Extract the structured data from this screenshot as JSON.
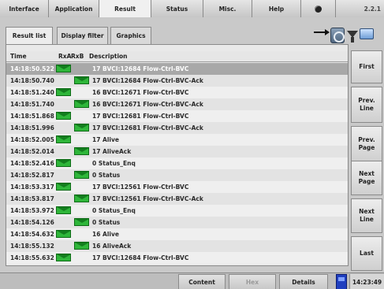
{
  "top_tabs": [
    {
      "label": "Interface"
    },
    {
      "label": "Application"
    },
    {
      "label": "Result"
    },
    {
      "label": "Status"
    },
    {
      "label": "Misc."
    },
    {
      "label": "Help"
    },
    {
      "label": ""
    },
    {
      "label": "2.2.1"
    }
  ],
  "sub_tabs": {
    "result_list": "Result list",
    "display_filter": "Display filter",
    "graphics": "Graphics"
  },
  "table": {
    "columns": {
      "time": "Time",
      "rxa": "RxA",
      "rxb": "RxB",
      "description": "Description"
    },
    "rows": [
      {
        "time": "14:18:50.522",
        "rx": "A",
        "desc": "17 BVCI:12684 Flow-Ctrl-BVC",
        "selected": true
      },
      {
        "time": "14:18:50.740",
        "rx": "B",
        "desc": "17 BVCI:12684 Flow-Ctrl-BVC-Ack"
      },
      {
        "time": "14:18:51.240",
        "rx": "A",
        "desc": "16 BVCI:12671 Flow-Ctrl-BVC"
      },
      {
        "time": "14:18:51.740",
        "rx": "B",
        "desc": "16 BVCI:12671 Flow-Ctrl-BVC-Ack"
      },
      {
        "time": "14:18:51.868",
        "rx": "A",
        "desc": "17 BVCI:12681 Flow-Ctrl-BVC"
      },
      {
        "time": "14:18:51.996",
        "rx": "B",
        "desc": "17 BVCI:12681 Flow-Ctrl-BVC-Ack"
      },
      {
        "time": "14:18:52.005",
        "rx": "A",
        "desc": "17 Alive"
      },
      {
        "time": "14:18:52.014",
        "rx": "B",
        "desc": "17 AliveAck"
      },
      {
        "time": "14:18:52.416",
        "rx": "A",
        "desc": "0 Status_Enq"
      },
      {
        "time": "14:18:52.817",
        "rx": "B",
        "desc": "0 Status"
      },
      {
        "time": "14:18:53.317",
        "rx": "A",
        "desc": "17 BVCI:12561 Flow-Ctrl-BVC"
      },
      {
        "time": "14:18:53.817",
        "rx": "B",
        "desc": "17 BVCI:12561 Flow-Ctrl-BVC-Ack"
      },
      {
        "time": "14:18:53.972",
        "rx": "A",
        "desc": "0 Status_Enq"
      },
      {
        "time": "14:18:54.126",
        "rx": "B",
        "desc": "0 Status"
      },
      {
        "time": "14:18:54.632",
        "rx": "A",
        "desc": "16 Alive"
      },
      {
        "time": "14:18:55.132",
        "rx": "B",
        "desc": "16 AliveAck"
      },
      {
        "time": "14:18:55.632",
        "rx": "A",
        "desc": "17 BVCI:12684 Flow-Ctrl-BVC"
      }
    ]
  },
  "nav_buttons": {
    "first": "First",
    "prev_line": "Prev.\nLine",
    "prev_page": "Prev.\nPage",
    "next_page": "Next\nPage",
    "next_line": "Next\nLine",
    "last": "Last"
  },
  "bottom": {
    "content": "Content",
    "hex": "Hex",
    "details": "Details",
    "clock": "14:23:49"
  },
  "icons": [
    "arrow-right-icon",
    "database-icon",
    "filter-icon",
    "screen-icon",
    "gear-icon",
    "phone-icon",
    "envelope-icon"
  ]
}
